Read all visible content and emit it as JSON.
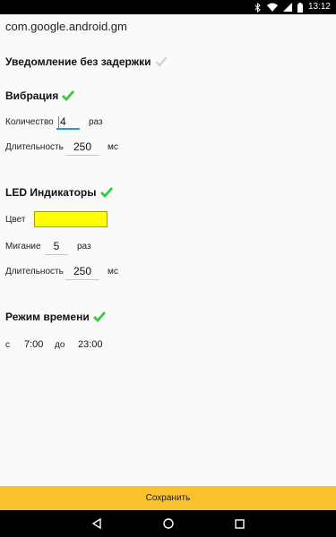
{
  "status_bar": {
    "time": "13:12",
    "icons": [
      "bluetooth-icon",
      "wifi-icon",
      "signal-icon",
      "battery-icon"
    ]
  },
  "package_name": "com.google.android.gm",
  "instant_notification": {
    "label": "Уведомление без задержки",
    "checked": false
  },
  "vibration": {
    "title": "Вибрация",
    "enabled": true,
    "count_label": "Количество",
    "count_value": "4",
    "count_unit": "раз",
    "duration_label": "Длительность",
    "duration_value": "250",
    "duration_unit": "мс"
  },
  "led": {
    "title": "LED Индикаторы",
    "enabled": true,
    "color_label": "Цвет",
    "color": "#ffff00",
    "blink_label": "Мигание",
    "blink_value": "5",
    "blink_unit": "раз",
    "duration_label": "Длительность",
    "duration_value": "250",
    "duration_unit": "мс"
  },
  "time_mode": {
    "title": "Режим времени",
    "enabled": true,
    "from_label": "с",
    "from_value": "7:00",
    "to_label": "до",
    "to_value": "23:00"
  },
  "save_label": "Сохранить",
  "colors": {
    "accent": "#fbc02d",
    "check_green": "#2ecc40",
    "check_gray": "#d6d6d6",
    "focus_blue": "#2196f3"
  }
}
